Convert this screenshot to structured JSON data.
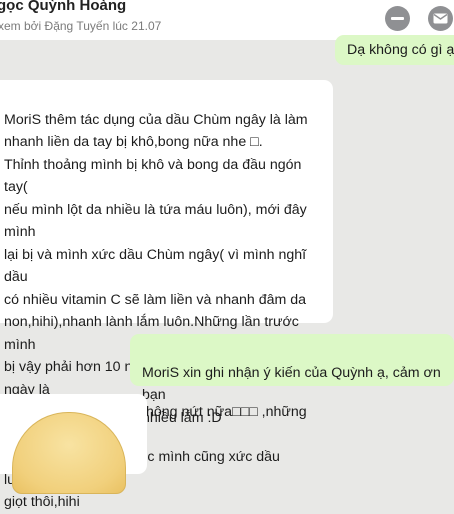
{
  "header": {
    "contact_name": "gọc Quỳnh Hoàng",
    "seen_status": "xem bởi Đặng Tuyến lúc 21.07"
  },
  "icons": {
    "remove": "minus-circle-icon",
    "mail": "mail-icon"
  },
  "colors": {
    "outgoing_bubble": "#dcf8c6",
    "incoming_bubble": "#ffffff",
    "background": "#e8e8e6",
    "header_button": "#8f9093"
  },
  "messages": [
    {
      "direction": "outgoing",
      "text": "Dạ không có gì ạ :"
    },
    {
      "direction": "incoming",
      "text": "MoriS thêm tác dụng của dầu Chùm ngây là làm\nnhanh liền da tay bị khô,bong nữa nhe □.\nThỉnh thoảng mình bị khô và bong da đầu ngón tay(\nnếu mình lột da nhiều là tứa máu luôn), mới đây mình\nlại bị và mình xức dầu Chùm ngây( vì mình nghĩ dầu\ncó nhiều vitamin C sẽ làm liền và nhanh đâm da\nnon,hihi),nhanh lành lắm luôn.Những lần trước mình\nbị vậy phải hơn 10 ngày mới liền,lần này có 4 ngày là\nliền da rồi,không khô không nứt nữa□□□ ,những lần\nbị đứt tay hay trầy xước mình cũng xức dầu luôn,1-2\ngiọt thôi,hihi"
    },
    {
      "direction": "outgoing",
      "text": "MoriS xin ghi nhận ý kiến của Quỳnh ạ, cảm ơn bạn\nnhiều lắm :D"
    },
    {
      "direction": "incoming",
      "text": ""
    }
  ]
}
